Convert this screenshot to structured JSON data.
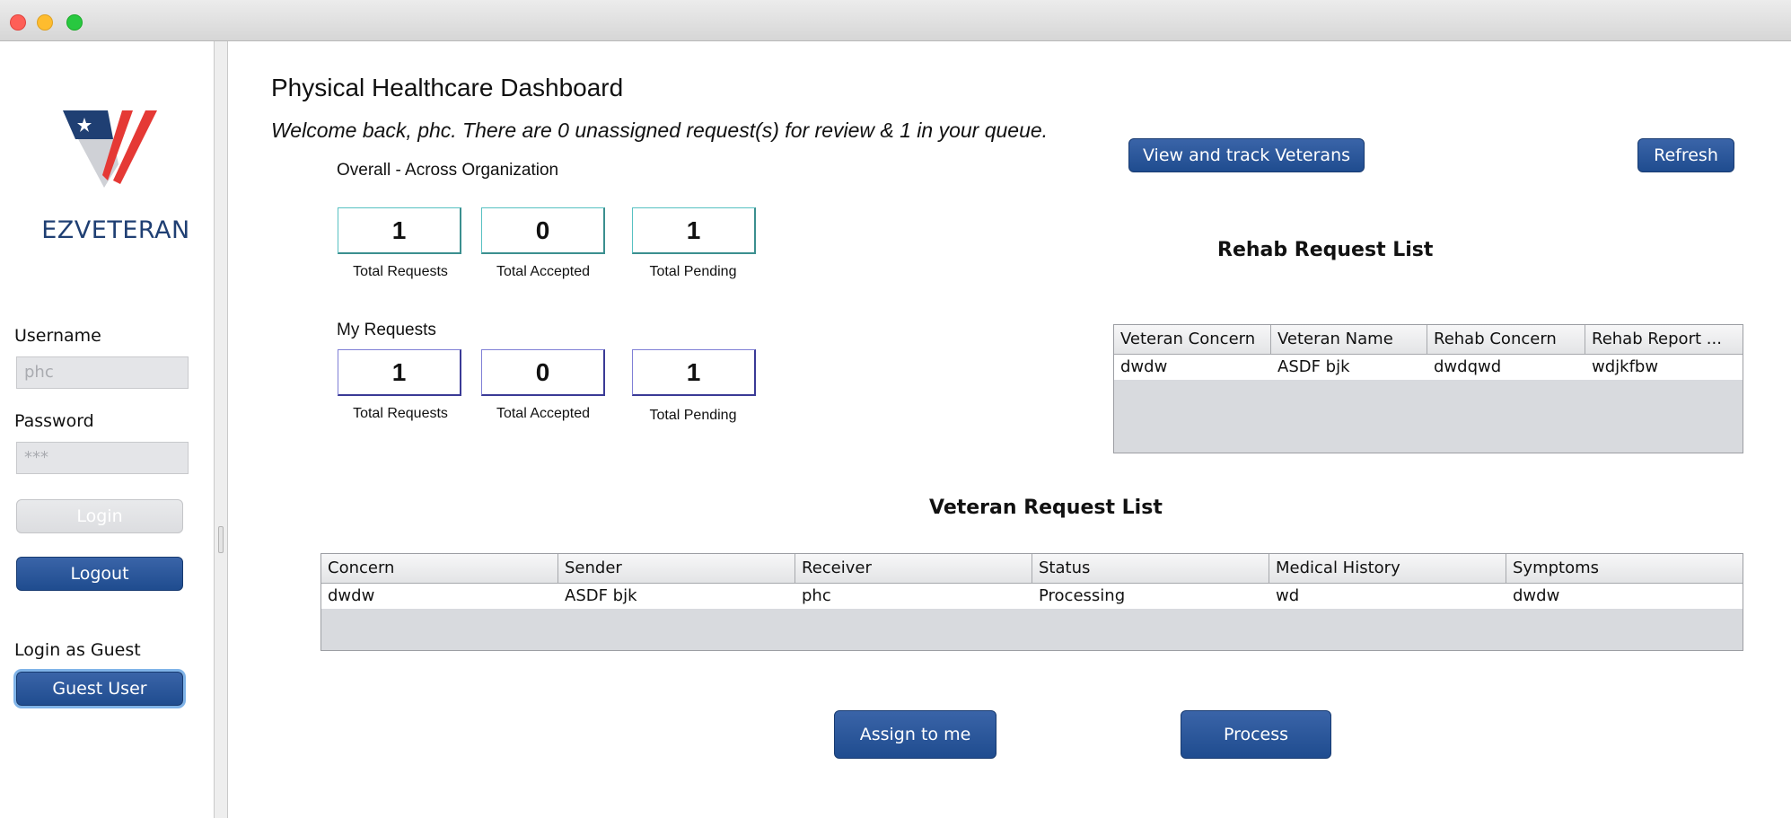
{
  "sidebar": {
    "brand": "EZVETERAN",
    "username_label": "Username",
    "username_value": "phc",
    "password_label": "Password",
    "password_value": "***",
    "login_button": "Login",
    "logout_button": "Logout",
    "guest_label": "Login as Guest",
    "guest_button": "Guest User"
  },
  "header": {
    "title": "Physical Healthcare Dashboard",
    "welcome": "Welcome back, phc. There are 0 unassigned request(s) for review & 1 in your queue."
  },
  "actions": {
    "view_track": "View and track Veterans",
    "refresh": "Refresh",
    "assign": "Assign to me",
    "process": "Process"
  },
  "overall": {
    "label": "Overall - Across Organization",
    "stats": [
      {
        "value": "1",
        "caption": "Total Requests"
      },
      {
        "value": "0",
        "caption": "Total Accepted"
      },
      {
        "value": "1",
        "caption": "Total Pending"
      }
    ]
  },
  "mine": {
    "label": "My Requests",
    "stats": [
      {
        "value": "1",
        "caption": "Total Requests"
      },
      {
        "value": "0",
        "caption": "Total Accepted"
      },
      {
        "value": "1",
        "caption": "Total Pending"
      }
    ]
  },
  "rehab": {
    "title": "Rehab  Request List",
    "columns": [
      "Veteran Concern",
      "Veteran Name",
      "Rehab Concern",
      "Rehab Report ..."
    ],
    "rows": [
      [
        "dwdw",
        "ASDF bjk",
        "dwdqwd",
        "wdjkfbw"
      ]
    ]
  },
  "veteran": {
    "title": "Veteran Request List",
    "columns": [
      "Concern",
      "Sender",
      "Receiver",
      "Status",
      "Medical History",
      "Symptoms"
    ],
    "rows": [
      [
        "dwdw",
        "ASDF bjk",
        "phc",
        "Processing",
        "wd",
        "dwdw"
      ]
    ]
  },
  "colors": {
    "button_blue": "#1f4c8f",
    "logo_red": "#e53935",
    "logo_navy": "#1f3f73"
  }
}
